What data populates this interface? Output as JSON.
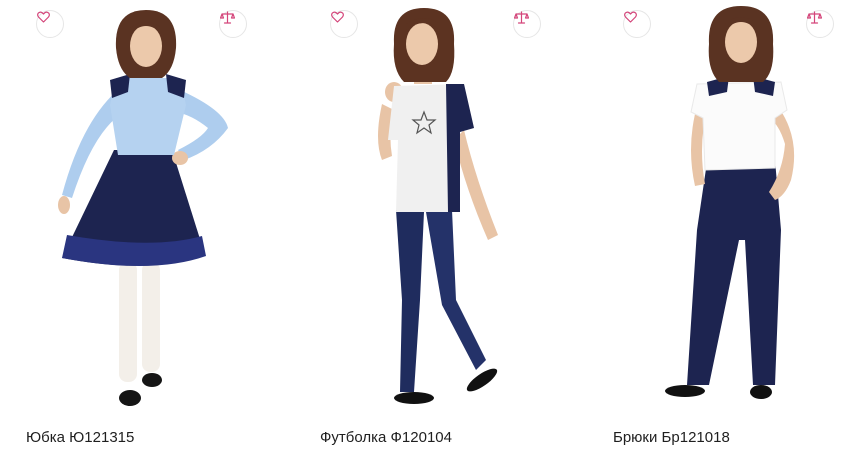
{
  "colors": {
    "accent": "#d4457a",
    "text": "#1f1f1f"
  },
  "products": [
    {
      "title": "Юбка Ю121315",
      "favorite_icon": "heart-outline-icon",
      "compare_icon": "scales-icon"
    },
    {
      "title": "Футболка Ф120104",
      "favorite_icon": "heart-outline-icon",
      "compare_icon": "scales-icon"
    },
    {
      "title": "Брюки Бр121018",
      "favorite_icon": "heart-outline-icon",
      "compare_icon": "scales-icon"
    }
  ]
}
